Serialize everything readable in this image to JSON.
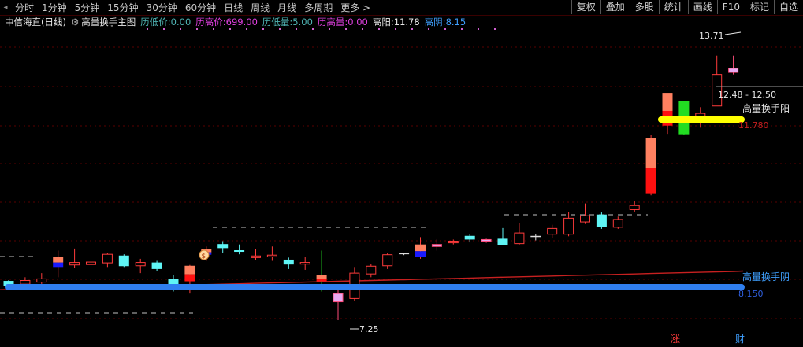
{
  "toolbar": {
    "timeframes": [
      "分时",
      "1分钟",
      "5分钟",
      "15分钟",
      "30分钟",
      "60分钟",
      "日线",
      "周线",
      "月线",
      "多周期",
      "更多 >"
    ],
    "buttons": [
      "复权",
      "叠加",
      "多股",
      "统计",
      "画线",
      "F10",
      "标记",
      "自选"
    ]
  },
  "info": {
    "stock": "中信海直(日线)",
    "indicator": "高量换手主图",
    "items": [
      {
        "label": "历低价:",
        "value": "0.00",
        "color": "#4fb3b3"
      },
      {
        "label": "历高价:",
        "value": "699.00",
        "color": "#e040e0"
      },
      {
        "label": "历低量:",
        "value": "5.00",
        "color": "#4fb3b3"
      },
      {
        "label": "历高量:",
        "value": "0.00",
        "color": "#e040e0"
      },
      {
        "label": "高阳:",
        "value": "11.78",
        "color": "#e8e8e8"
      },
      {
        "label": "高阴:",
        "value": "8.15",
        "color": "#3fa0ff"
      }
    ]
  },
  "annotations": {
    "high": "13.71",
    "low": "7.25",
    "range": "12.48 - 12.50",
    "yang_label": "高量换手阳",
    "yang_value": "11.780",
    "yin_label": "高量换手阴",
    "yin_value": "8.150",
    "zhang": "涨",
    "cai": "财",
    "money": "$"
  },
  "colors": {
    "up": "#ff3b3b",
    "down": "#5ff5f5",
    "yang_line": "#ffff00",
    "yin_line": "#2f7fef",
    "ma": "#c82020"
  },
  "chart_data": {
    "type": "candlestick",
    "x": [
      1,
      2,
      3,
      4,
      5,
      6,
      7,
      8,
      9,
      10,
      11,
      12,
      13,
      14,
      15,
      16,
      17,
      18,
      19,
      20,
      21,
      22,
      23,
      24,
      25,
      26,
      27,
      28,
      29,
      30,
      31,
      32,
      33,
      34,
      35,
      36,
      37,
      38,
      39,
      40,
      41,
      42,
      43,
      44,
      45
    ],
    "candles": [
      {
        "o": 8.2,
        "h": 8.23,
        "l": 8.05,
        "c": 8.1,
        "d": "d"
      },
      {
        "o": 8.13,
        "h": 8.3,
        "l": 8.1,
        "c": 8.22,
        "d": "u"
      },
      {
        "o": 8.18,
        "h": 8.4,
        "l": 8.06,
        "c": 8.26,
        "d": "u"
      },
      {
        "o": 8.55,
        "h": 8.95,
        "l": 8.3,
        "c": 8.79,
        "d": "u",
        "hi": 1
      },
      {
        "o": 8.6,
        "h": 9.0,
        "l": 8.52,
        "c": 8.66,
        "d": "u"
      },
      {
        "o": 8.61,
        "h": 8.78,
        "l": 8.55,
        "c": 8.67,
        "d": "u"
      },
      {
        "o": 8.65,
        "h": 8.9,
        "l": 8.55,
        "c": 8.86,
        "d": "u"
      },
      {
        "o": 8.82,
        "h": 8.86,
        "l": 8.55,
        "c": 8.58,
        "d": "d"
      },
      {
        "o": 8.58,
        "h": 8.75,
        "l": 8.4,
        "c": 8.66,
        "d": "u"
      },
      {
        "o": 8.65,
        "h": 8.7,
        "l": 8.45,
        "c": 8.51,
        "d": "d"
      },
      {
        "o": 8.25,
        "h": 8.35,
        "l": 7.95,
        "c": 8.0,
        "d": "d"
      },
      {
        "o": 8.2,
        "h": 8.6,
        "l": 7.9,
        "c": 8.58,
        "d": "u",
        "hi": 1
      },
      {
        "o": 8.85,
        "h": 9.05,
        "l": 8.7,
        "c": 8.98,
        "d": "u",
        "hi": 1
      },
      {
        "o": 9.1,
        "h": 9.18,
        "l": 8.9,
        "c": 9.02,
        "d": "d"
      },
      {
        "o": 8.95,
        "h": 9.1,
        "l": 8.86,
        "c": 8.93,
        "d": "d"
      },
      {
        "o": 8.78,
        "h": 8.98,
        "l": 8.72,
        "c": 8.82,
        "d": "u"
      },
      {
        "o": 8.8,
        "h": 9.05,
        "l": 8.7,
        "c": 8.84,
        "d": "u"
      },
      {
        "o": 8.62,
        "h": 8.78,
        "l": 8.5,
        "c": 8.72,
        "d": "d"
      },
      {
        "o": 8.66,
        "h": 8.8,
        "l": 8.48,
        "c": 8.62,
        "d": "u"
      },
      {
        "o": 8.2,
        "h": 8.95,
        "l": 7.95,
        "c": 8.35,
        "d": "g",
        "hi": 1
      },
      {
        "o": 7.9,
        "h": 8.05,
        "l": 7.25,
        "c": 7.7,
        "d": "p"
      },
      {
        "o": 7.78,
        "h": 8.55,
        "l": 7.72,
        "c": 8.4,
        "d": "u"
      },
      {
        "o": 8.38,
        "h": 8.62,
        "l": 8.3,
        "c": 8.57,
        "d": "u"
      },
      {
        "o": 8.58,
        "h": 8.9,
        "l": 8.5,
        "c": 8.85,
        "d": "u"
      },
      {
        "o": 8.88,
        "h": 8.9,
        "l": 8.84,
        "c": 8.88,
        "d": "x"
      },
      {
        "o": 8.8,
        "h": 9.28,
        "l": 8.75,
        "c": 9.1,
        "d": "u",
        "hi": 1
      },
      {
        "o": 9.1,
        "h": 9.23,
        "l": 8.95,
        "c": 9.05,
        "d": "p"
      },
      {
        "o": 9.18,
        "h": 9.22,
        "l": 9.1,
        "c": 9.14,
        "d": "u"
      },
      {
        "o": 9.3,
        "h": 9.35,
        "l": 9.15,
        "c": 9.23,
        "d": "d"
      },
      {
        "o": 9.22,
        "h": 9.24,
        "l": 9.14,
        "c": 9.18,
        "d": "p"
      },
      {
        "o": 9.23,
        "h": 9.5,
        "l": 9.1,
        "c": 9.1,
        "d": "d"
      },
      {
        "o": 9.12,
        "h": 9.62,
        "l": 9.08,
        "c": 9.38,
        "d": "u"
      },
      {
        "o": 9.3,
        "h": 9.35,
        "l": 9.2,
        "c": 9.3,
        "d": "x"
      },
      {
        "o": 9.35,
        "h": 9.58,
        "l": 9.25,
        "c": 9.49,
        "d": "u"
      },
      {
        "o": 9.35,
        "h": 9.9,
        "l": 9.3,
        "c": 9.74,
        "d": "u"
      },
      {
        "o": 9.65,
        "h": 10.1,
        "l": 9.6,
        "c": 9.8,
        "d": "u"
      },
      {
        "o": 9.82,
        "h": 9.88,
        "l": 9.48,
        "c": 9.54,
        "d": "d"
      },
      {
        "o": 9.52,
        "h": 9.78,
        "l": 9.48,
        "c": 9.71,
        "d": "u"
      },
      {
        "o": 9.95,
        "h": 10.15,
        "l": 9.9,
        "c": 10.05,
        "d": "u"
      },
      {
        "o": 10.35,
        "h": 11.78,
        "l": 10.3,
        "c": 11.7,
        "d": "u",
        "hi": 1
      },
      {
        "o": 12.0,
        "h": 12.5,
        "l": 11.8,
        "c": 12.8,
        "d": "u",
        "hi": 1
      },
      {
        "o": 11.8,
        "h": 12.6,
        "l": 11.78,
        "c": 12.6,
        "d": "g"
      },
      {
        "o": 12.1,
        "h": 12.45,
        "l": 11.95,
        "c": 12.3,
        "d": "u"
      },
      {
        "o": 12.48,
        "h": 13.71,
        "l": 12.48,
        "c": 13.25,
        "d": "u"
      },
      {
        "o": 13.4,
        "h": 13.71,
        "l": 13.25,
        "c": 13.3,
        "d": "p"
      }
    ],
    "ma": [
      8.0,
      8.01,
      8.02,
      8.03,
      8.04,
      8.05,
      8.06,
      8.07,
      8.08,
      8.09,
      8.1,
      8.11,
      8.12,
      8.13,
      8.14,
      8.15,
      8.16,
      8.17,
      8.18,
      8.19,
      8.2,
      8.21,
      8.22,
      8.23,
      8.24,
      8.25,
      8.26,
      8.27,
      8.28,
      8.29,
      8.3,
      8.31,
      8.32,
      8.33,
      8.34,
      8.35,
      8.36,
      8.37,
      8.38,
      8.39,
      8.4,
      8.41,
      8.42,
      8.43,
      8.44
    ],
    "high_yang": 11.78,
    "high_yin": 8.15,
    "ylim": [
      7.0,
      14.3
    ]
  }
}
